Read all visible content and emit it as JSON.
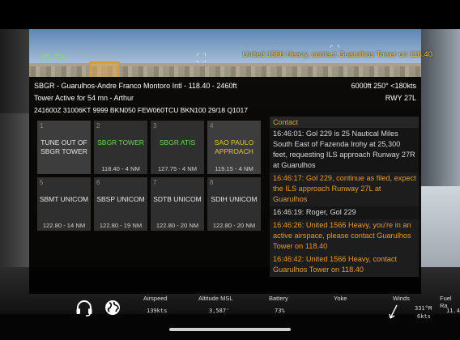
{
  "hud": {
    "left_readout": "H1  71%",
    "message": "United 1566 Heavy, contact Guarulhos Tower on 118.40"
  },
  "atc": {
    "header": {
      "airport_line": "SBGR - Guarulhos-Andre Franco Montoro Intl - 118.40 - 2460ft",
      "altitude_speed": "6000ft  250° <180kts",
      "tower_line": "Tower Active for 54 mn - Arthur",
      "runway": "RWY 27L",
      "metar": "241600Z 31006KT 9999 BKN050 FEW060TCU BKN100 29/18 Q1017"
    },
    "frequencies": [
      {
        "num": "1",
        "name": "TUNE OUT OF SBGR TOWER",
        "freq": "",
        "style": "plain"
      },
      {
        "num": "2",
        "name": "SBGR TOWER",
        "freq": "118.40 - 4 NM",
        "style": "green"
      },
      {
        "num": "3",
        "name": "SBGR ATIS",
        "freq": "127.75 - 4 NM",
        "style": "green"
      },
      {
        "num": "4",
        "name": "SAO PAULO APPROACH",
        "freq": "119.15 - 4 NM",
        "style": "yellow"
      },
      {
        "num": "5",
        "name": "SBMT UNICOM",
        "freq": "122.80 - 14 NM",
        "style": "plain"
      },
      {
        "num": "6",
        "name": "SBSP UNICOM",
        "freq": "122.80 - 19 NM",
        "style": "plain"
      },
      {
        "num": "7",
        "name": "SDTB UNICOM",
        "freq": "122.80 - 20 NM",
        "style": "plain"
      },
      {
        "num": "8",
        "name": "SDIH UNICOM",
        "freq": "122.80 - 20 NM",
        "style": "plain"
      }
    ],
    "contact": {
      "title": "Contact",
      "messages": [
        {
          "text": "16:46:01: Gol 229 is 25 Nautical Miles South East of Fazenda Irohy at 25,300 feet, requesting ILS approach Runway 27R at Guarulhos",
          "style": "white"
        },
        {
          "text": "16:46:17: Gol 229, continue as filed, expect the ILS approach Runway 27L at Guarulhos",
          "style": "orange"
        },
        {
          "text": "16:46:19: Roger, Gol 229",
          "style": "white"
        },
        {
          "text": "16:46:26: United 1566 Heavy, you're in an active airspace,  please contact Guarulhos Tower on 118.40",
          "style": "orange"
        },
        {
          "text": "16:46:42: United 1566 Heavy, contact Guarulhos Tower on 118.40",
          "style": "orange"
        }
      ]
    }
  },
  "status_bar": {
    "airspeed": {
      "label": "Airspeed",
      "value": "139kts"
    },
    "altitude": {
      "label": "Altitude MSL",
      "value": "3,587'"
    },
    "battery": {
      "label": "Battery",
      "value": "73%"
    },
    "yoke": {
      "label": "Yoke",
      "value": ""
    },
    "winds": {
      "label": "Winds",
      "value_dir": "331°M",
      "value_speed": "6kts"
    },
    "fuel": {
      "label": "Fuel Ra",
      "value": "11.4"
    }
  },
  "colors": {
    "accent_green": "#6dd35a",
    "accent_yellow": "#e6c53a",
    "accent_orange": "#e89a2a"
  }
}
